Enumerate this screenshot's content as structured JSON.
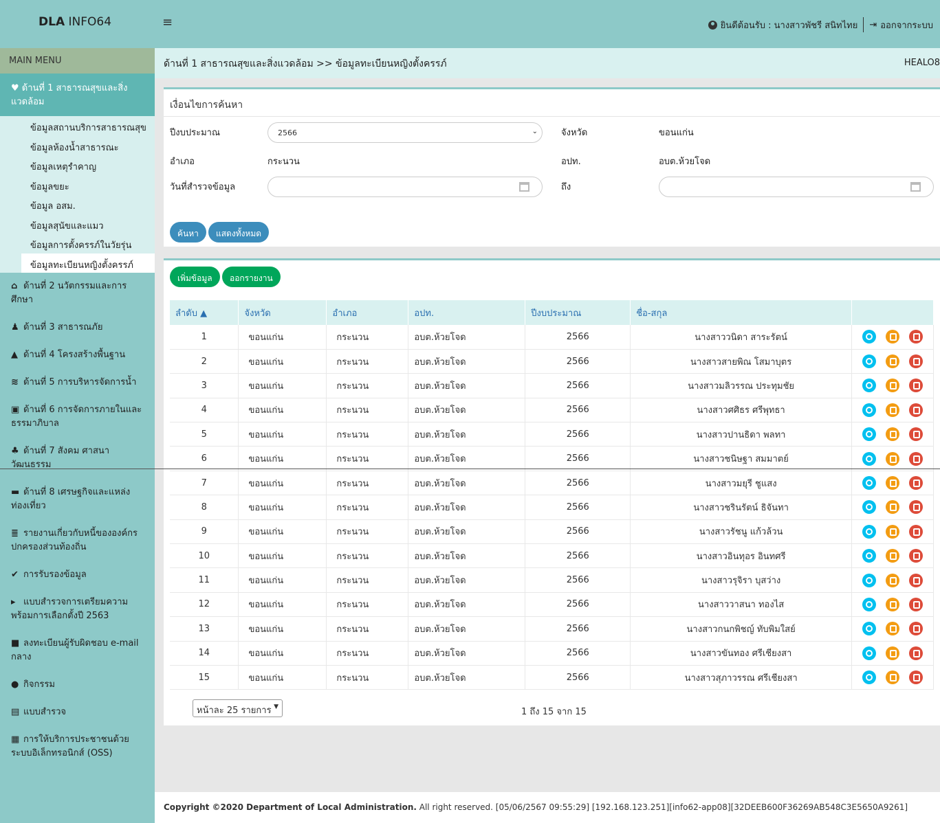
{
  "header": {
    "brand_bold": "DLA",
    "brand_rest": " INFO64",
    "welcome": "ยินดีต้อนรับ : นางสาวพัชรี สนิทไทย",
    "logout": "ออกจากระบบ"
  },
  "sidebar": {
    "menu_head": "MAIN MENU",
    "active": "ด้านที่ 1 สาธารณสุขและสิ่งแวดล้อม",
    "subitems": [
      "ข้อมูลสถานบริการสาธารณสุข",
      "ข้อมูลห้องน้ำสาธารณะ",
      "ข้อมูลเหตุรำคาญ",
      "ข้อมูลขยะ",
      "ข้อมูล อสม.",
      "ข้อมูลสุนัขและแมว",
      "ข้อมูลการตั้งครรภ์ในวัยรุ่น",
      "ข้อมูลทะเบียนหญิงตั้งครรภ์"
    ],
    "items": [
      {
        "icon": "school-icon",
        "glyph": "⌂",
        "label": "ด้านที่ 2 นวัตกรรมและการศึกษา"
      },
      {
        "icon": "users-icon",
        "glyph": "♟",
        "label": "ด้านที่ 3 สาธารณภัย"
      },
      {
        "icon": "road-icon",
        "glyph": "▲",
        "label": "ด้านที่ 4 โครงสร้างพื้นฐาน"
      },
      {
        "icon": "water-icon",
        "glyph": "≋",
        "label": "ด้านที่ 5 การบริหารจัดการน้ำ"
      },
      {
        "icon": "building-icon",
        "glyph": "▣",
        "label": "ด้านที่ 6 การจัดการภายในและธรรมาภิบาล"
      },
      {
        "icon": "people-icon",
        "glyph": "♣",
        "label": "ด้านที่ 7 สังคม ศาสนา วัฒนธรรม"
      },
      {
        "icon": "money-icon",
        "glyph": "▬",
        "label": "ด้านที่ 8 เศรษฐกิจและแหล่งท่องเที่ยว"
      },
      {
        "icon": "database-icon",
        "glyph": "≣",
        "label": "รายงานเกี่ยวกับหนี้ขององค์กรปกครองส่วนท้องถิ่น"
      },
      {
        "icon": "check-icon",
        "glyph": "✔",
        "label": "การรับรองข้อมูล"
      },
      {
        "icon": "caret-right-icon",
        "glyph": "▸",
        "label": "แบบสำรวจการเตรียมความพร้อมการเลือกตั้งปี 2563"
      },
      {
        "icon": "register-icon",
        "glyph": "■",
        "label": "ลงทะเบียนผู้รับผิดชอบ e-mail กลาง"
      },
      {
        "icon": "user-icon",
        "glyph": "●",
        "label": "กิจกรรม"
      },
      {
        "icon": "file-icon",
        "glyph": "▤",
        "label": "แบบสำรวจ"
      },
      {
        "icon": "service-icon",
        "glyph": "▦",
        "label": "การให้บริการประชาชนด้วยระบบอิเล็กทรอนิกส์ (OSS)"
      }
    ]
  },
  "breadcrumb": {
    "text": "ด้านที่ 1 สาธารณสุขและสิ่งแวดล้อม >> ข้อมูลทะเบียนหญิงตั้งครรภ์",
    "right": "HEALO8"
  },
  "search": {
    "title": "เงื่อนไขการค้นหา",
    "year_label": "ปีงบประมาณ",
    "year_value": "2566",
    "province_label": "จังหวัด",
    "province_value": "ขอนแก่น",
    "district_label": "อำเภอ",
    "district_value": "กระนวน",
    "org_label": "อปท.",
    "org_value": "อบต.ห้วยโจด",
    "date_label": "วันที่สำรวจข้อมูล",
    "to_label": "ถึง",
    "search_btn": "ค้นหา",
    "showall_btn": "แสดงทั้งหมด"
  },
  "list": {
    "add_btn": "เพิ่มข้อมูล",
    "report_btn": "ออกรายงาน",
    "columns": [
      "ลำดับ ▲",
      "จังหวัด",
      "อำเภอ",
      "อปท.",
      "ปีงบประมาณ",
      "ชื่อ-สกุล",
      ""
    ],
    "rows": [
      [
        "1",
        "ขอนแก่น",
        "กระนวน",
        "อบต.ห้วยโจด",
        "2566",
        "นางสาววนิดา สาระรัตน์"
      ],
      [
        "2",
        "ขอนแก่น",
        "กระนวน",
        "อบต.ห้วยโจด",
        "2566",
        "นางสาวสายพิณ โสมาบุตร"
      ],
      [
        "3",
        "ขอนแก่น",
        "กระนวน",
        "อบต.ห้วยโจด",
        "2566",
        "นางสาวมลิวรรณ ประทุมชัย"
      ],
      [
        "4",
        "ขอนแก่น",
        "กระนวน",
        "อบต.ห้วยโจด",
        "2566",
        "นางสาวศศิธร ศรีพุทธา"
      ],
      [
        "5",
        "ขอนแก่น",
        "กระนวน",
        "อบต.ห้วยโจด",
        "2566",
        "นางสาวปานธิดา พลทา"
      ],
      [
        "6",
        "ขอนแก่น",
        "กระนวน",
        "อบต.ห้วยโจด",
        "2566",
        "นางสาวชนิษฐา สมมาตย์"
      ],
      [
        "7",
        "ขอนแก่น",
        "กระนวน",
        "อบต.ห้วยโจด",
        "2566",
        "นางสาวมยุรี ชูแสง"
      ],
      [
        "8",
        "ขอนแก่น",
        "กระนวน",
        "อบต.ห้วยโจด",
        "2566",
        "นางสาวชรินรัตน์ ธิจันทา"
      ],
      [
        "9",
        "ขอนแก่น",
        "กระนวน",
        "อบต.ห้วยโจด",
        "2566",
        "นางสาวรัชนู แก้วล้วน"
      ],
      [
        "10",
        "ขอนแก่น",
        "กระนวน",
        "อบต.ห้วยโจด",
        "2566",
        "นางสาวอินทุอร อินทศรี"
      ],
      [
        "11",
        "ขอนแก่น",
        "กระนวน",
        "อบต.ห้วยโจด",
        "2566",
        "นางสาวรุจิรา บุสว่าง"
      ],
      [
        "12",
        "ขอนแก่น",
        "กระนวน",
        "อบต.ห้วยโจด",
        "2566",
        "นางสาววาสนา ทองไส"
      ],
      [
        "13",
        "ขอนแก่น",
        "กระนวน",
        "อบต.ห้วยโจด",
        "2566",
        "นางสาวกนกพิชญ์ ทับพิมใสย์"
      ],
      [
        "14",
        "ขอนแก่น",
        "กระนวน",
        "อบต.ห้วยโจด",
        "2566",
        "นางสาวขันทอง ศรีเชียงสา"
      ],
      [
        "15",
        "ขอนแก่น",
        "กระนวน",
        "อบต.ห้วยโจด",
        "2566",
        "นางสาวสุภาวรรณ ศรีเชียงสา"
      ]
    ],
    "page_size": "หน้าละ 25 รายการ",
    "info": "1 ถึง 15 จาก 15"
  },
  "footer": {
    "bold": "Copyright ©2020 Department of Local Administration.",
    "rest": " All right reserved. [05/06/2567 09:55:29] [192.168.123.251][info62-app08][32DEEB600F36269AB548C3E5650A9261]"
  },
  "colors": {
    "topbar": "#8dc9c8",
    "active_menu": "#5fb6b3",
    "btn_blue": "#3c8dbc",
    "btn_green": "#00a65a",
    "view": "#00c0ef",
    "edit": "#f39c12",
    "delete": "#dd4b39"
  }
}
